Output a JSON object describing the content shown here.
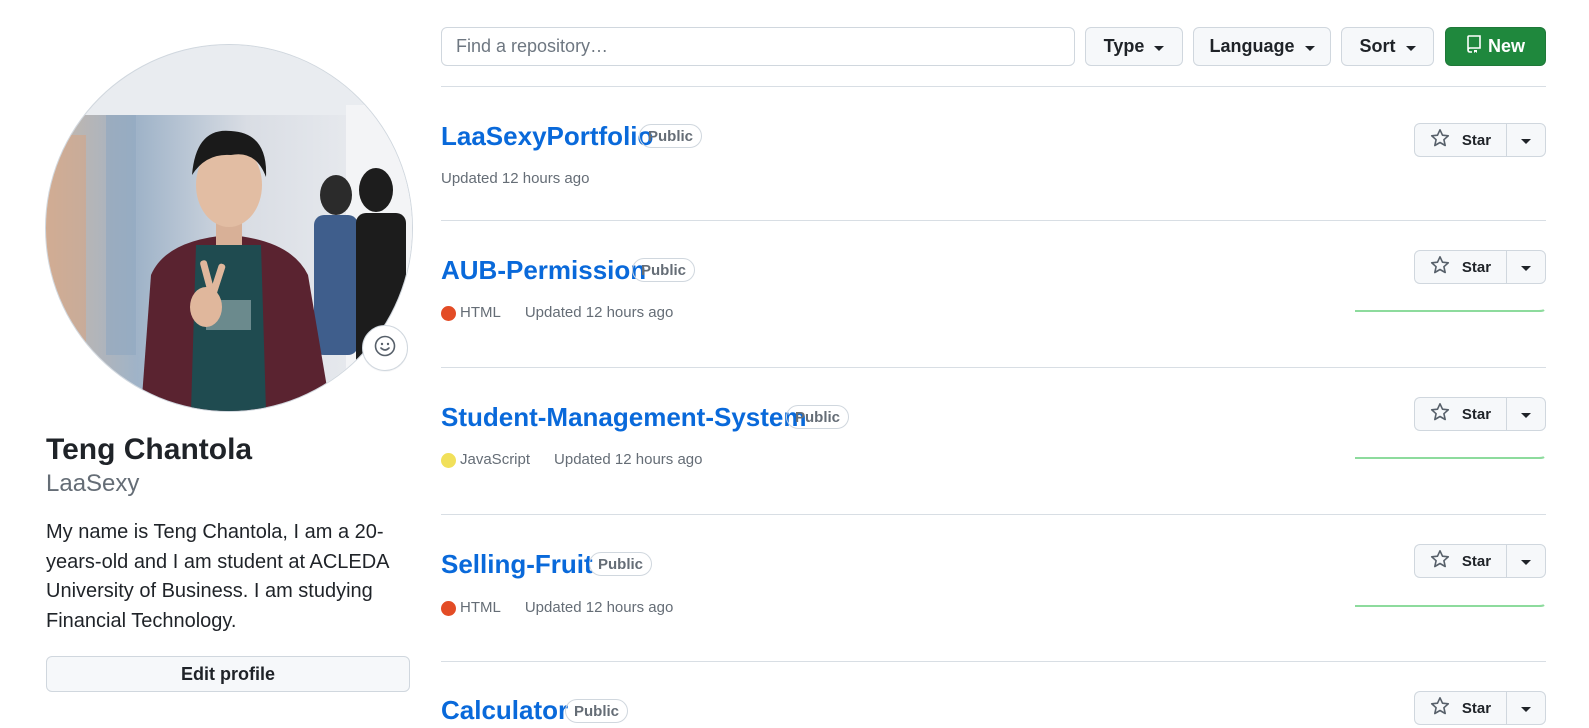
{
  "profile": {
    "full_name": "Teng Chantola",
    "username": "LaaSexy",
    "bio": "My name is Teng Chantola, I am a 20-years-old and I am student at ACLEDA University of Business. I am studying Financial Technology.",
    "edit_label": "Edit profile",
    "status_icon": "smiley-icon"
  },
  "toolbar": {
    "search_placeholder": "Find a repository…",
    "type_label": "Type",
    "language_label": "Language",
    "sort_label": "Sort",
    "new_label": "New"
  },
  "repos": [
    {
      "name": "LaaSexyPortfolio",
      "visibility": "Public",
      "language": "",
      "language_color": "",
      "updated": "Updated 12 hours ago",
      "star_label": "Star",
      "has_activity": false
    },
    {
      "name": "AUB-Permission",
      "visibility": "Public",
      "language": "HTML",
      "language_color": "#e34c26",
      "updated": "Updated 12 hours ago",
      "star_label": "Star",
      "has_activity": true
    },
    {
      "name": "Student-Management-System",
      "visibility": "Public",
      "language": "JavaScript",
      "language_color": "#f1e05a",
      "updated": "Updated 12 hours ago",
      "star_label": "Star",
      "has_activity": true
    },
    {
      "name": "Selling-Fruit",
      "visibility": "Public",
      "language": "HTML",
      "language_color": "#e34c26",
      "updated": "Updated 12 hours ago",
      "star_label": "Star",
      "has_activity": true
    },
    {
      "name": "Calculator",
      "visibility": "Public",
      "language": "",
      "language_color": "",
      "updated": "",
      "star_label": "Star",
      "has_activity": false
    }
  ],
  "colors": {
    "accent_link": "#0969da",
    "primary_button": "#1f883d",
    "activity_line": "#8ddb9d"
  }
}
